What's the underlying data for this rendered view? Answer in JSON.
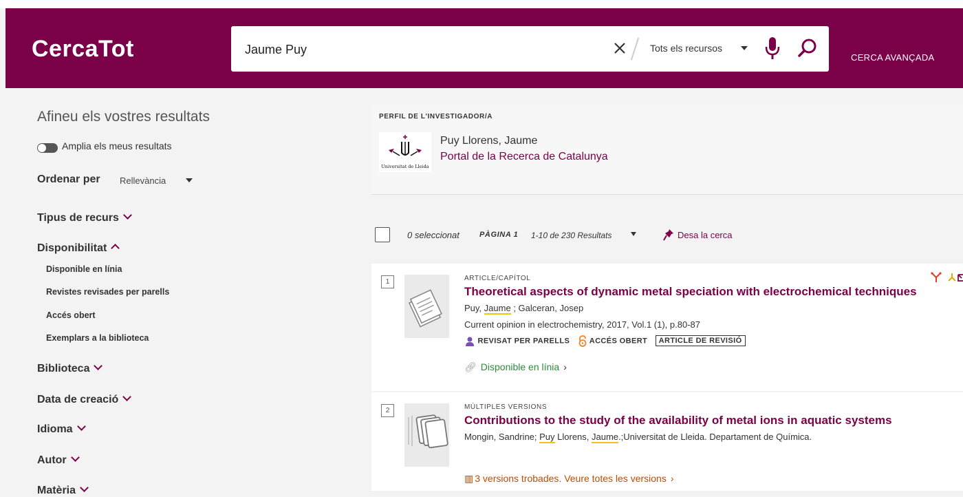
{
  "header": {
    "logo": "CercaTot",
    "search_value": "Jaume Puy",
    "scope_label": "Tots els recursos",
    "advanced_label": "CERCA AVANÇADA",
    "colors": {
      "brand": "#7a0047"
    }
  },
  "sidebar": {
    "title": "Afineu els vostres resultats",
    "expand_toggle_label": "Amplia els meus resultats",
    "sort_label": "Ordenar per",
    "sort_value": "Rellevància",
    "facets": [
      {
        "label": "Tipus de recurs",
        "expanded": false
      },
      {
        "label": "Disponibilitat",
        "expanded": true,
        "options": [
          "Disponible en línia",
          "Revistes revisades per parells",
          "Accés obert",
          "Exemplars a la biblioteca"
        ]
      },
      {
        "label": "Biblioteca",
        "expanded": false
      },
      {
        "label": "Data de creació",
        "expanded": false
      },
      {
        "label": "Idioma",
        "expanded": false
      },
      {
        "label": "Autor",
        "expanded": false
      },
      {
        "label": "Matèria",
        "expanded": false
      }
    ]
  },
  "profile": {
    "heading": "PERFIL DE L'INVESTIGADOR/A",
    "logo_caption": "Universitat de Lleida",
    "name": "Puy Llorens, Jaume",
    "link": "Portal de la Recerca de Catalunya"
  },
  "toolbar": {
    "selected": "0 seleccionat",
    "page": "PÀGINA 1",
    "range": "1-10 de 230 Resultats",
    "save_search": "Desa la cerca"
  },
  "results": [
    {
      "num": "1",
      "type": "ARTICLE/CAPÍTOL",
      "title": "Theoretical aspects of dynamic metal speciation with electrochemical techniques",
      "authors_pre": "Puy, ",
      "authors_hl": "Jaume",
      "authors_post": " ; Galceran, Josep",
      "source": "Current opinion in electrochemistry, 2017, Vol.1 (1), p.80-87",
      "badge_peer": "REVISAT PER PARELLS",
      "badge_oa": "ACCÉS OBERT",
      "badge_type": "ARTICLE DE REVISIÓ",
      "availability": "Disponible en línia"
    },
    {
      "num": "2",
      "type": "MÚLTIPLES VERSIONS",
      "title": "Contributions to the study of the availability of metal ions in aquatic systems",
      "authors_pre": "Mongin, Sandrine; ",
      "authors_hl1": "Puy",
      "authors_mid": " Llorens, ",
      "authors_hl2": "Jaume",
      "authors_post": ".;Universitat de Lleida. Departament de Química.",
      "versions": "3 versions trobades. Veure totes les versions"
    }
  ]
}
